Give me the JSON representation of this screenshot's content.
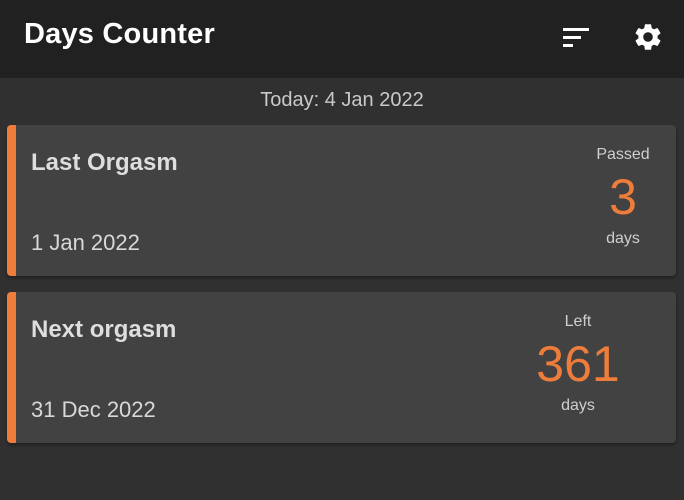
{
  "appbar": {
    "title": "Days Counter",
    "sort_icon": "sort-icon",
    "settings_icon": "gear-icon"
  },
  "today_label": "Today: 4 Jan 2022",
  "colors": {
    "accent": "#ee7d3b",
    "background": "#303030",
    "appbar": "#212121",
    "card": "#424242"
  },
  "cards": [
    {
      "title": "Last Orgasm",
      "date": "1 Jan 2022",
      "counter_label": "Passed",
      "count": "3",
      "unit": "days"
    },
    {
      "title": "Next orgasm",
      "date": "31 Dec 2022",
      "counter_label": "Left",
      "count": "361",
      "unit": "days"
    }
  ]
}
